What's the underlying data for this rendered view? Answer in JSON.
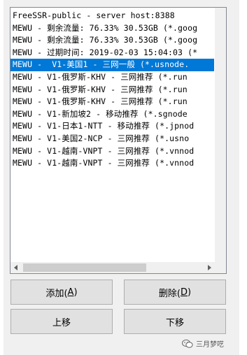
{
  "server_list": {
    "items": [
      "FreeSSR-public - server host:8388",
      "MEWU - 剩余流量: 76.33% 30.53GB (*.goog",
      "MEWU - 剩余流量: 76.33% 30.53GB (*.goog",
      "MEWU - 过期时间: 2019-02-03 15:04:03 (*",
      "MEWU -  V1-美国1 - 三网一般 (*.usnode.",
      "MEWU - V1-俄罗斯-KHV - 三网推荐 (*.run",
      "MEWU - V1-俄罗斯-KHV - 三网推荐 (*.run",
      "MEWU - V1-俄罗斯-KHV - 三网推荐 (*.run",
      "MEWU - V1-新加坡2 - 移动推荐 (*.sgnode",
      "MEWU - V1-日本1-NTT - 移动推荐 (*.jpnod",
      "MEWU - V1-美国2-NCP - 三网推荐 (*.usno",
      "MEWU - V1-越南-VNPT - 三网推荐 (*.vnnod",
      "MEWU - V1-越南-VNPT - 三网推荐 (*.vnnod"
    ],
    "selected_index": 4,
    "scroll_left_icon": "arrow-left",
    "scroll_right_icon": "arrow-right",
    "selection_color": "#0078d7"
  },
  "buttons": {
    "add": {
      "label": "添加(",
      "mnemonic": "A",
      "suffix": ")"
    },
    "delete": {
      "label": "删除(",
      "mnemonic": "D",
      "suffix": ")"
    },
    "move_up": {
      "label": "上移"
    },
    "move_down": {
      "label": "下移"
    }
  },
  "watermark": {
    "text": "三月梦呓",
    "icon": "wechat-icon"
  }
}
